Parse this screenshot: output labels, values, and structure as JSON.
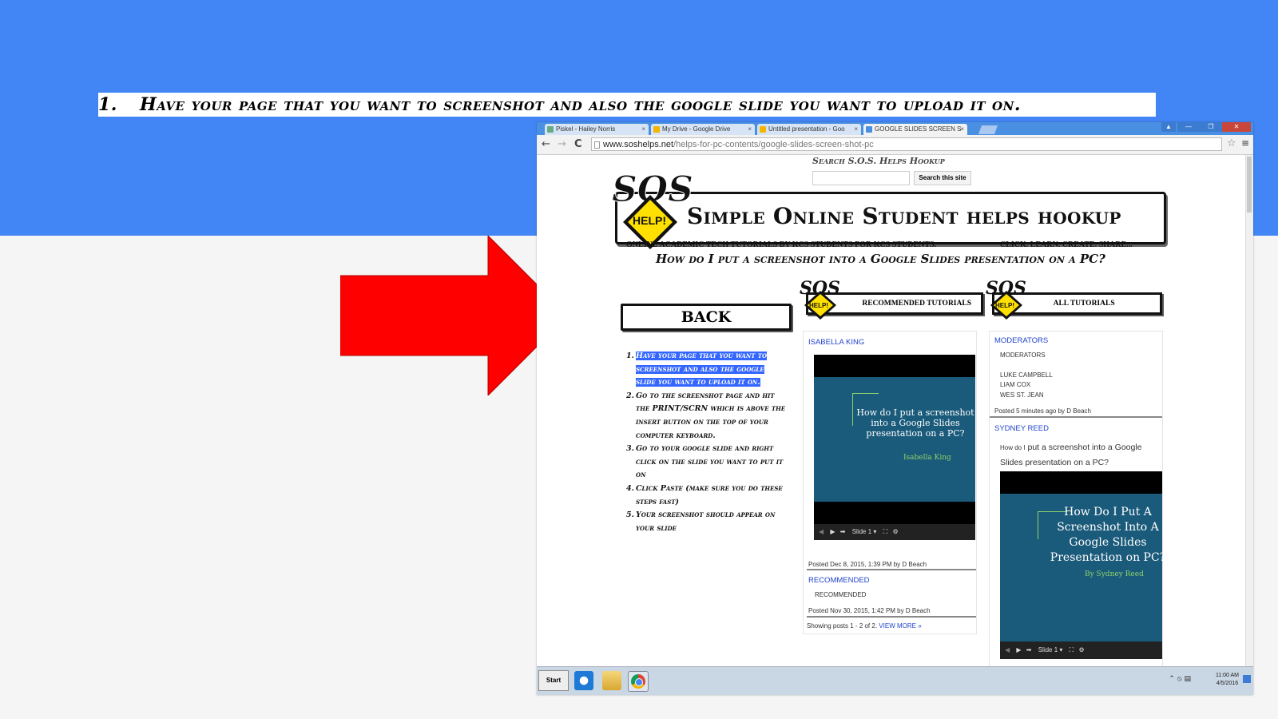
{
  "slide": {
    "step_number": "1.",
    "title": "Have your page that you want to screenshot and also the google slide you want to upload it on."
  },
  "browser": {
    "tabs": [
      {
        "label": "Piskel - Hailey Norris",
        "close": "×"
      },
      {
        "label": "My Drive - Google Drive",
        "close": "×"
      },
      {
        "label": "Untitled presentation - Goo",
        "close": "×"
      },
      {
        "label": "GOOGLE SLIDES SCREEN S",
        "close": "×"
      }
    ],
    "window_controls": [
      "▲",
      "—",
      "❐",
      "✕"
    ],
    "back_icon": "←",
    "forward_icon": "→",
    "reload_icon": "C",
    "url_domain": "www.soshelps.net",
    "url_path": "/helps-for-pc-contents/google-slides-screen-shot-pc",
    "star_icon": "☆",
    "menu_icon": "≡"
  },
  "site": {
    "search_title": "Search S.O.S. Helps Hookup",
    "search_button": "Search this site",
    "banner_title": "Simple Online Student helps hookup",
    "logo_help": "HELP!",
    "logo_sos": "SOS",
    "tagline": "ONLINE ACADEMIC TECH TUTORIALS BY KCS STUDENTS FOR KCS STUDENTS.",
    "tagline2": "CLICK. LEARN. CREATE. SHARE...",
    "question": "How do I put a screenshot into a Google Slides presentation on a PC?",
    "back_label": "BACK",
    "recommended_header": "RECOMMENDED TUTORIALS",
    "all_header": "ALL TUTORIALS"
  },
  "steps": [
    {
      "n": "1.",
      "text": "Have your page that you want to screenshot and also the google slide you want to upload it on."
    },
    {
      "n": "2.",
      "text": "Go to the screenshot page and hit the PRINT/SCRN which is above the insert button on the top of your computer keyboard."
    },
    {
      "n": "3.",
      "text": "Go to your google slide and right click on the slide you want to put it on"
    },
    {
      "n": "4.",
      "text": "Click Paste (make sure you do these steps fast)"
    },
    {
      "n": "5.",
      "text": "Your screenshot should appear on your slide"
    }
  ],
  "recommended": {
    "post1_title": "ISABELLA KING",
    "video1_title": "How do I put a screenshot into a Google Slides presentation on a PC?",
    "video1_author": "Isabella King",
    "video1_slide": "Slide 1 ▾",
    "post1_meta": "Posted Dec 8, 2015, 1:39 PM by D Beach",
    "post2_title": "RECOMMENDED",
    "post2_body": "RECOMMENDED",
    "post2_meta": "Posted Nov 30, 2015, 1:42 PM by D Beach",
    "showing": "Showing posts 1 - 2 of 2.",
    "view_more": "VIEW MORE »"
  },
  "all": {
    "post1_title": "MODERATORS",
    "post1_body": "MODERATORS",
    "names": [
      "LUKE CAMPBELL",
      "LIAM COX",
      "WES ST. JEAN"
    ],
    "post1_meta": "Posted 5 minutes ago by D Beach",
    "post2_title": "SYDNEY REED",
    "post2_prefix": "How do I",
    "post2_body": "put a screenshot into a Google Slides presentation on a PC?",
    "video2_title": "How Do I Put A Screenshot Into A Google Slides Presentation on PC?",
    "video2_author": "By Sydney Reed",
    "video2_slide": "Slide 1 ▾"
  },
  "taskbar": {
    "start": "Start",
    "time": "11:00 AM",
    "date": "4/5/2016"
  },
  "colors": {
    "slide_blue": "#4285f4",
    "arrow_red": "#ff0000",
    "highlight": "#3366ff",
    "logo_yellow": "#ffe000"
  }
}
